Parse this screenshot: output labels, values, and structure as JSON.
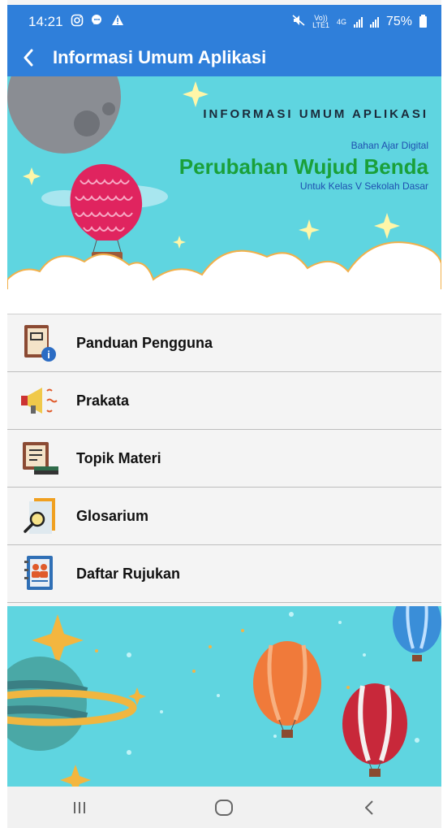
{
  "status_bar": {
    "time": "14:21",
    "signal_label_top": "Vo))",
    "signal_label_bottom": "LTE1",
    "network": "4G",
    "battery": "75%"
  },
  "app_bar": {
    "title": "Informasi Umum Aplikasi",
    "back_icon": "back-arrow-icon"
  },
  "banner": {
    "title": "INFORMASI UMUM APLIKASI",
    "subtitle_top": "Bahan Ajar Digital",
    "main_title": "Perubahan Wujud Benda",
    "subtitle_bottom": "Untuk Kelas V Sekolah Dasar"
  },
  "menu": {
    "items": [
      {
        "label": "Panduan Pengguna",
        "icon": "user-guide-book-icon"
      },
      {
        "label": "Prakata",
        "icon": "megaphone-icon"
      },
      {
        "label": "Topik Materi",
        "icon": "books-icon"
      },
      {
        "label": "Glosarium",
        "icon": "magnifier-document-icon"
      },
      {
        "label": "Daftar Rujukan",
        "icon": "address-book-icon"
      }
    ]
  },
  "nav_bar": {
    "recent_icon": "recent-apps-icon",
    "home_icon": "home-icon",
    "back_icon": "nav-back-icon"
  },
  "colors": {
    "app_bar": "#2f7fda",
    "banner_bg": "#5fd5e0",
    "banner_title_green": "#1aa03a",
    "banner_blue_text": "#1e4fb0"
  }
}
